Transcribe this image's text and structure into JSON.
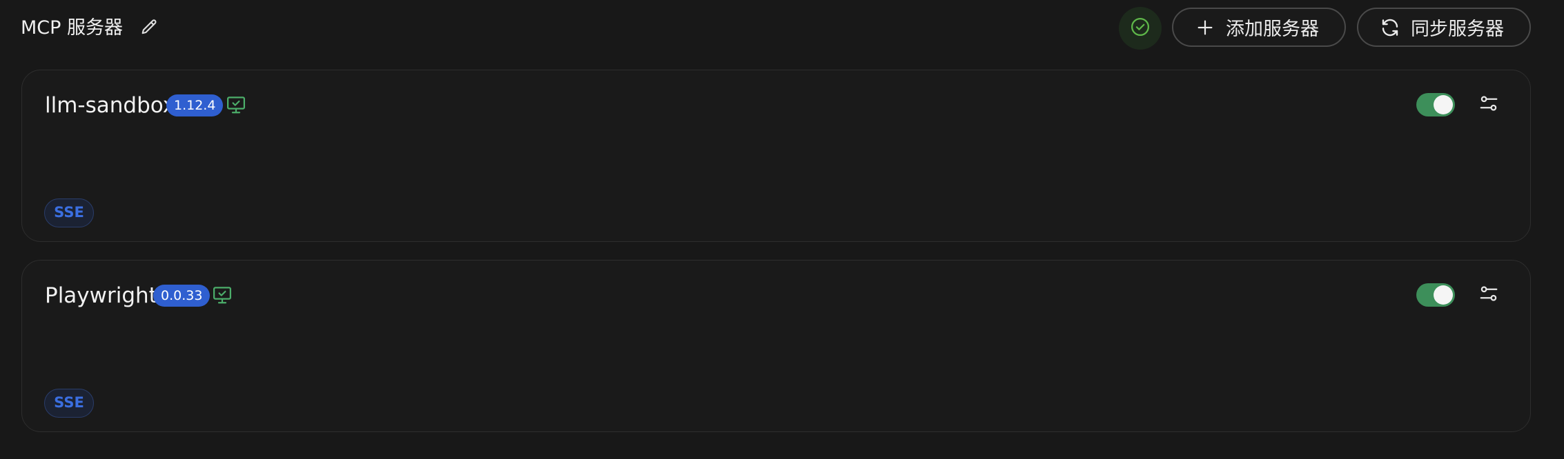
{
  "header": {
    "title": "MCP 服务器",
    "edit_icon": "pencil-icon",
    "status_icon": "check-circle-icon",
    "add_server_label": "添加服务器",
    "sync_server_label": "同步服务器"
  },
  "servers": [
    {
      "name": "llm-sandbox",
      "version": "1.12.4",
      "icon": "monitor-check-icon",
      "enabled": true,
      "transport": "SSE"
    },
    {
      "name": "Playwright",
      "version": "0.0.33",
      "icon": "monitor-check-icon",
      "enabled": true,
      "transport": "SSE"
    }
  ],
  "colors": {
    "background": "#181818",
    "version_badge": "#2f5fd0",
    "toggle_on": "#3d8f5a",
    "transport_text": "#3b6fe0",
    "status_green": "#5fb84a"
  }
}
